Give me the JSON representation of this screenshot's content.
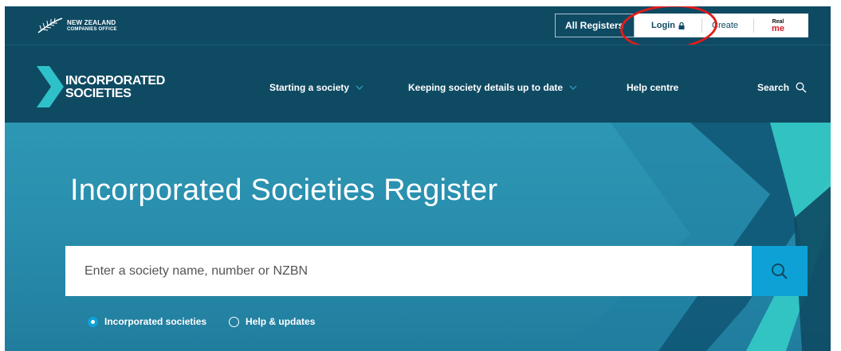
{
  "topbar": {
    "logo_line1": "NEW ZEALAND",
    "logo_line2": "COMPANIES OFFICE",
    "all_registers_label": "All Registers",
    "login_label": "Login",
    "create_label": "Create",
    "realme_line1": "Real",
    "realme_line2": "me"
  },
  "brand": {
    "line1": "INCORPORATED",
    "line2": "SOCIETIES"
  },
  "nav": {
    "items": [
      {
        "label": "Starting a society"
      },
      {
        "label": "Keeping society details up to date"
      },
      {
        "label": "Help centre"
      },
      {
        "label": "Search"
      }
    ]
  },
  "hero": {
    "title": "Incorporated Societies Register",
    "search_placeholder": "Enter a society name, number or NZBN",
    "filters": [
      {
        "label": "Incorporated societies",
        "checked": true
      },
      {
        "label": "Help & updates",
        "checked": false
      }
    ]
  },
  "colors": {
    "navy": "#0f4a63",
    "hero_teal": "#2a8fae",
    "accent_blue": "#0ea1d6",
    "annotation_red": "#e31b1b"
  }
}
